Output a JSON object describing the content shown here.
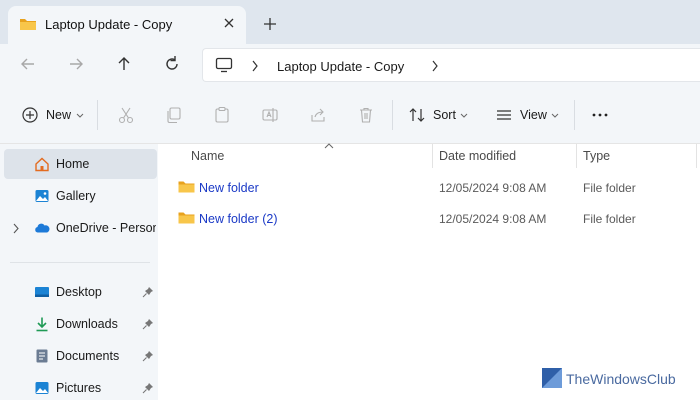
{
  "tab": {
    "title": "Laptop Update - Copy",
    "close_icon": "close-icon",
    "new_tab_icon": "plus-icon"
  },
  "nav": {
    "back_icon": "arrow-left-icon",
    "forward_icon": "arrow-right-icon",
    "up_icon": "arrow-up-icon",
    "refresh_icon": "refresh-icon"
  },
  "address": {
    "computer_icon": "computer-icon",
    "crumbs": [
      "Laptop Update - Copy"
    ]
  },
  "toolbar": {
    "new_label": "New",
    "sort_label": "Sort",
    "view_label": "View",
    "icons": [
      "new-icon",
      "cut-icon",
      "copy-icon",
      "paste-icon",
      "rename-icon",
      "share-icon",
      "delete-icon",
      "sort-icon",
      "view-icon",
      "more-icon"
    ]
  },
  "sidebar": {
    "items": [
      {
        "label": "Home",
        "icon": "home-icon",
        "selected": true
      },
      {
        "label": "Gallery",
        "icon": "gallery-icon"
      },
      {
        "label": "OneDrive - Personal",
        "icon": "onedrive-icon",
        "expandable": true
      },
      {
        "label": "Desktop",
        "icon": "desktop-icon",
        "pinned": true
      },
      {
        "label": "Downloads",
        "icon": "downloads-icon",
        "pinned": true
      },
      {
        "label": "Documents",
        "icon": "documents-icon",
        "pinned": true
      },
      {
        "label": "Pictures",
        "icon": "pictures-icon",
        "pinned": true
      }
    ]
  },
  "columns": {
    "name": "Name",
    "date": "Date modified",
    "type": "Type"
  },
  "files": [
    {
      "name": "New folder",
      "date": "12/05/2024 9:08 AM",
      "type": "File folder"
    },
    {
      "name": "New folder (2)",
      "date": "12/05/2024 9:08 AM",
      "type": "File folder"
    }
  ],
  "watermark": {
    "text": "TheWindowsClub"
  },
  "colors": {
    "accent": "#0067c0",
    "folder": "#f8c64a",
    "link": "#1a39c6",
    "chrome": "#dfe6ee",
    "pane": "#f3f6f9"
  }
}
